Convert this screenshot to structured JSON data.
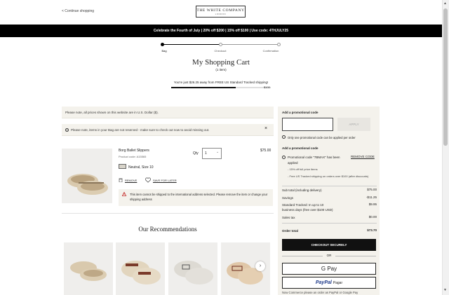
{
  "header": {
    "back_link": "< Continue shopping",
    "logo_main": "THE WHITE COMPANY",
    "logo_sub": "LONDON",
    "promo_banner": "Celebrate the Fourth of July | 20% off $200 | 15% off $100 | Use code: 4THJULY25"
  },
  "steps": [
    {
      "label": "Bag",
      "active": true
    },
    {
      "label": "Checkout",
      "active": false
    },
    {
      "label": "Confirmation",
      "active": false
    }
  ],
  "cart": {
    "title": "My Shopping Cart",
    "count": "(1 item)",
    "shipping_message": "You're just $26.25 away from FREE US Standard Tracked shipping!",
    "shipping_progress": 0.65,
    "shipping_goal": "$100"
  },
  "notices": {
    "currency": "Please note, all prices shown on this website are in U.S. Dollar ($).",
    "reserve": "Please note, items in your Bag are not reserved - make sure to check out now to avoid missing out."
  },
  "product": {
    "name": "Borg Ballet Slippers",
    "code": "Product code: A15565",
    "qty_label": "Qty",
    "qty_value": "1",
    "price": "$75.00",
    "variant": "Neutral, Size 10",
    "remove_label": "REMOVE",
    "save_label": "SAVE FOR LATER",
    "ship_warning": "This item cannot be shipped to the international address selected. Please remove the item or change your shipping address"
  },
  "recommendations": {
    "title": "Our Recommendations",
    "next_icon": "chevron-right-icon"
  },
  "side": {
    "promo_heading": "Add a promotional code",
    "promo_input_value": "",
    "apply_label": "APPLY",
    "one_promo_note": "Only one promotional code can be applied per order",
    "promo_heading_2": "Add a promotional code",
    "promo_applied": "Promotional code \"7BMAX\" has been applied",
    "remove_code": "REMOVE CODE",
    "promo_desc_1": "- 15% off full price items",
    "promo_desc_2": "- Free US Tracked shipping on orders over $100 (after discounts)",
    "summary": [
      {
        "label": "Sub total (including delivery)",
        "value": "$75.00"
      },
      {
        "label": "Savings",
        "value": "-$11.25"
      },
      {
        "label": "Standard Tracked: In up to 10 business days (free over $100 USD)",
        "value": "$9.95"
      },
      {
        "label": "Sales tax",
        "value": "$0.00"
      }
    ],
    "order_total_label": "Order total",
    "order_total_value": "$73.70",
    "checkout_label": "CHECKOUT SECURELY",
    "or_label": "OR",
    "gpay_label": "G Pay",
    "paypal_label": "PayPal",
    "paypal_sub": "Pagar",
    "bottom_note": "Now Commerce please an order as PayPal or Google Pay"
  },
  "colors": {
    "banner_bg": "#000000",
    "panel_bg": "#f4f2ec",
    "paypal_blue": "#1f3a8a"
  }
}
